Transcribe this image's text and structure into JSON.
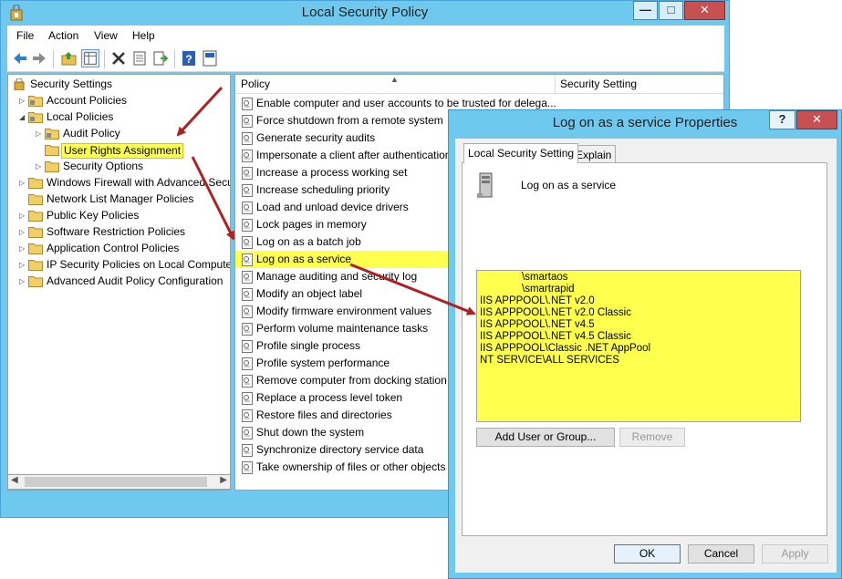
{
  "main_window": {
    "title": "Local Security Policy",
    "controls": {
      "minimize": "—",
      "maximize": "□",
      "close": "✕"
    }
  },
  "menu": [
    "File",
    "Action",
    "View",
    "Help"
  ],
  "toolbar_icons": [
    "back-icon",
    "forward-icon",
    "up-folder-icon",
    "show-hide-tree-icon",
    "delete-icon",
    "properties-icon",
    "export-list-icon",
    "help-icon",
    "help-topic-icon"
  ],
  "tree": {
    "root": "Security Settings",
    "items": [
      {
        "label": "Account Policies",
        "level": 1,
        "expander": "▷"
      },
      {
        "label": "Local Policies",
        "level": 1,
        "expander": "◢"
      },
      {
        "label": "Audit Policy",
        "level": 2,
        "expander": "▷"
      },
      {
        "label": "User Rights Assignment",
        "level": 2,
        "expander": ""
      },
      {
        "label": "Security Options",
        "level": 2,
        "expander": "▷"
      },
      {
        "label": "Windows Firewall with Advanced Security",
        "level": 1,
        "expander": "▷"
      },
      {
        "label": "Network List Manager Policies",
        "level": 1,
        "expander": ""
      },
      {
        "label": "Public Key Policies",
        "level": 1,
        "expander": "▷"
      },
      {
        "label": "Software Restriction Policies",
        "level": 1,
        "expander": "▷"
      },
      {
        "label": "Application Control Policies",
        "level": 1,
        "expander": "▷"
      },
      {
        "label": "IP Security Policies on Local Computer",
        "level": 1,
        "expander": "▷"
      },
      {
        "label": "Advanced Audit Policy Configuration",
        "level": 1,
        "expander": "▷"
      }
    ],
    "selected": "User Rights Assignment"
  },
  "list": {
    "columns": [
      "Policy",
      "Security Setting"
    ],
    "sort_arrow": "▲",
    "rows": [
      "Enable computer and user accounts to be trusted for delega...",
      "Force shutdown from a remote system",
      "Generate security audits",
      "Impersonate a client after authentication",
      "Increase a process working set",
      "Increase scheduling priority",
      "Load and unload device drivers",
      "Lock pages in memory",
      "Log on as a batch job",
      "Log on as a service",
      "Manage auditing and security log",
      "Modify an object label",
      "Modify firmware environment values",
      "Perform volume maintenance tasks",
      "Profile single process",
      "Profile system performance",
      "Remove computer from docking station",
      "Replace a process level token",
      "Restore files and directories",
      "Shut down the system",
      "Synchronize directory service data",
      "Take ownership of files or other objects"
    ],
    "selected": "Log on as a service"
  },
  "dialog": {
    "title": "Log on as a service Properties",
    "controls": {
      "help": "?",
      "close": "✕"
    },
    "tabs": [
      "Local Security Setting",
      "Explain"
    ],
    "policy_name": "Log on as a service",
    "accounts": [
      "\\smartaos",
      "\\smartrapid",
      "IIS APPPOOL\\.NET v2.0",
      "IIS APPPOOL\\.NET v2.0 Classic",
      "IIS APPPOOL\\.NET v4.5",
      "IIS APPPOOL\\.NET v4.5 Classic",
      "IIS APPPOOL\\Classic .NET AppPool",
      "NT SERVICE\\ALL SERVICES"
    ],
    "buttons": {
      "add": "Add User or Group...",
      "remove": "Remove",
      "ok": "OK",
      "cancel": "Cancel",
      "apply": "Apply"
    }
  },
  "colors": {
    "highlight": "#ffff4d",
    "arrow": "#b02020",
    "title_bar": "#6fc8ee"
  }
}
